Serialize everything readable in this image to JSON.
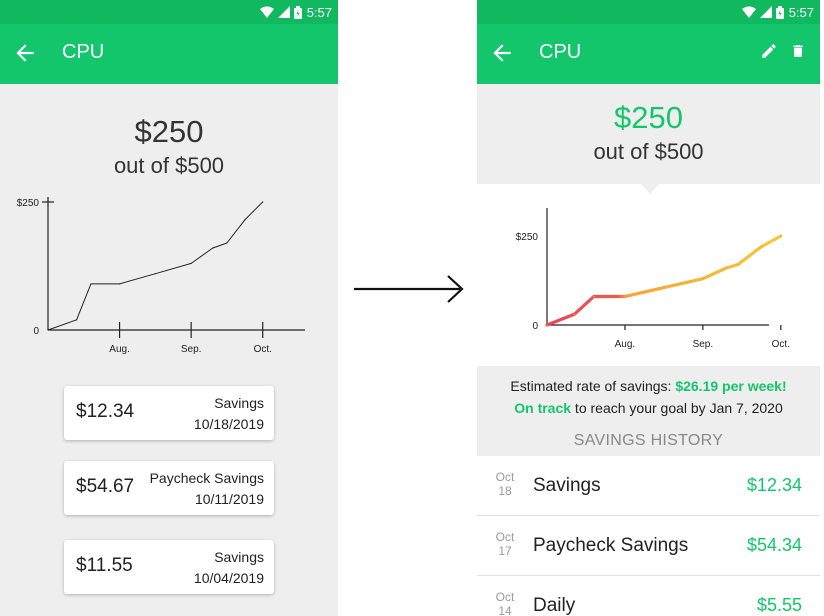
{
  "status_bar": {
    "time": "5:57",
    "icons": [
      "wifi-icon",
      "cell-signal-icon",
      "battery-icon"
    ]
  },
  "colors": {
    "app_bar": "#13c66b",
    "status_bar": "#10b85f",
    "accent_green": "#13c66b",
    "chart_start": "#e8455a",
    "chart_mid": "#f7a43a",
    "chart_end": "#f5c93a"
  },
  "left_screen": {
    "app_bar": {
      "title": "CPU",
      "back_icon": "arrow-left-icon"
    },
    "goal": {
      "amount": "$250",
      "out_of": "out of $500"
    },
    "transactions": [
      {
        "amount": "$12.34",
        "description": "Savings",
        "date": "10/18/2019"
      },
      {
        "amount": "$54.67",
        "description": "Paycheck Savings",
        "date": "10/11/2019"
      },
      {
        "amount": "$11.55",
        "description": "Savings",
        "date": "10/04/2019"
      }
    ]
  },
  "right_screen": {
    "app_bar": {
      "title": "CPU",
      "back_icon": "arrow-left-icon",
      "edit_icon": "pencil-icon",
      "delete_icon": "trash-icon"
    },
    "goal": {
      "amount": "$250",
      "out_of": "out of $500"
    },
    "rate_prefix": "Estimated rate of savings: ",
    "rate_value": "$26.19 per week!",
    "on_track_label": "On track",
    "on_track_suffix": " to reach your goal by Jan 7, 2020",
    "history_title": "SAVINGS HISTORY",
    "history": [
      {
        "month": "Oct",
        "day": "18",
        "name": "Savings",
        "amount": "$12.34"
      },
      {
        "month": "Oct",
        "day": "17",
        "name": "Paycheck Savings",
        "amount": "$54.34"
      },
      {
        "month": "Oct",
        "day": "14",
        "name": "Daily",
        "amount": "$5.55"
      }
    ]
  },
  "chart_data": [
    {
      "type": "line",
      "title": "",
      "y_tick_labels": [
        "0",
        "$250"
      ],
      "x_tick_labels": [
        "Aug.",
        "Sep.",
        "Oct."
      ],
      "x": [
        0,
        0.4,
        0.6,
        1.0,
        1.5,
        2.0,
        2.3,
        2.5,
        2.75,
        3.0
      ],
      "values": [
        0,
        20,
        90,
        90,
        110,
        130,
        160,
        170,
        215,
        250
      ],
      "ylim": [
        0,
        250
      ],
      "xlim": [
        0,
        3.8
      ],
      "grid": false
    },
    {
      "type": "line",
      "title": "",
      "y_tick_labels": [
        "0",
        "$250"
      ],
      "x_tick_labels": [
        "Aug.",
        "Sep.",
        "Oct."
      ],
      "x": [
        0,
        0.35,
        0.6,
        1.0,
        1.5,
        2.0,
        2.3,
        2.45,
        2.75,
        3.0
      ],
      "values": [
        0,
        30,
        80,
        80,
        105,
        130,
        160,
        170,
        220,
        250
      ],
      "ylim": [
        0,
        250
      ],
      "xlim": [
        0,
        3.4
      ],
      "grid": false
    }
  ]
}
